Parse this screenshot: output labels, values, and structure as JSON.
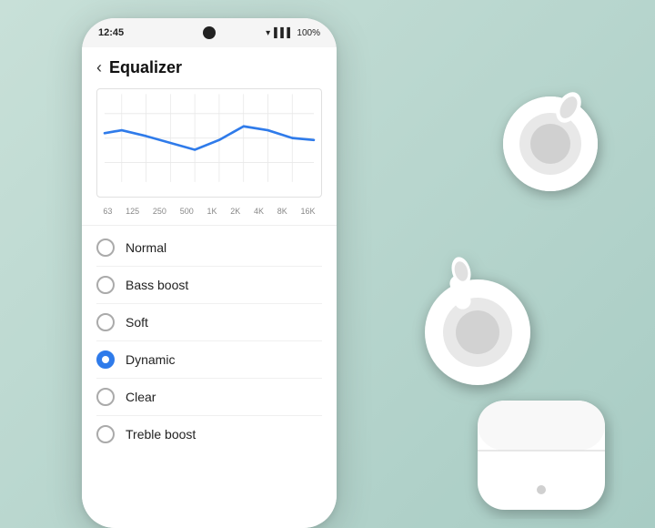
{
  "background": {
    "color": "#b8d0c8"
  },
  "statusBar": {
    "time": "12:45",
    "battery": "100%",
    "signal": "WiFi + LTE"
  },
  "header": {
    "backLabel": "‹",
    "title": "Equalizer"
  },
  "chart": {
    "freqLabels": [
      "63",
      "125",
      "250",
      "500",
      "1K",
      "2K",
      "4K",
      "8K",
      "16K"
    ]
  },
  "equalizerOptions": [
    {
      "id": "normal",
      "label": "Normal",
      "selected": false
    },
    {
      "id": "bass-boost",
      "label": "Bass boost",
      "selected": false
    },
    {
      "id": "soft",
      "label": "Soft",
      "selected": false
    },
    {
      "id": "dynamic",
      "label": "Dynamic",
      "selected": true
    },
    {
      "id": "clear",
      "label": "Clear",
      "selected": false
    },
    {
      "id": "treble-boost",
      "label": "Treble boost",
      "selected": false
    }
  ]
}
